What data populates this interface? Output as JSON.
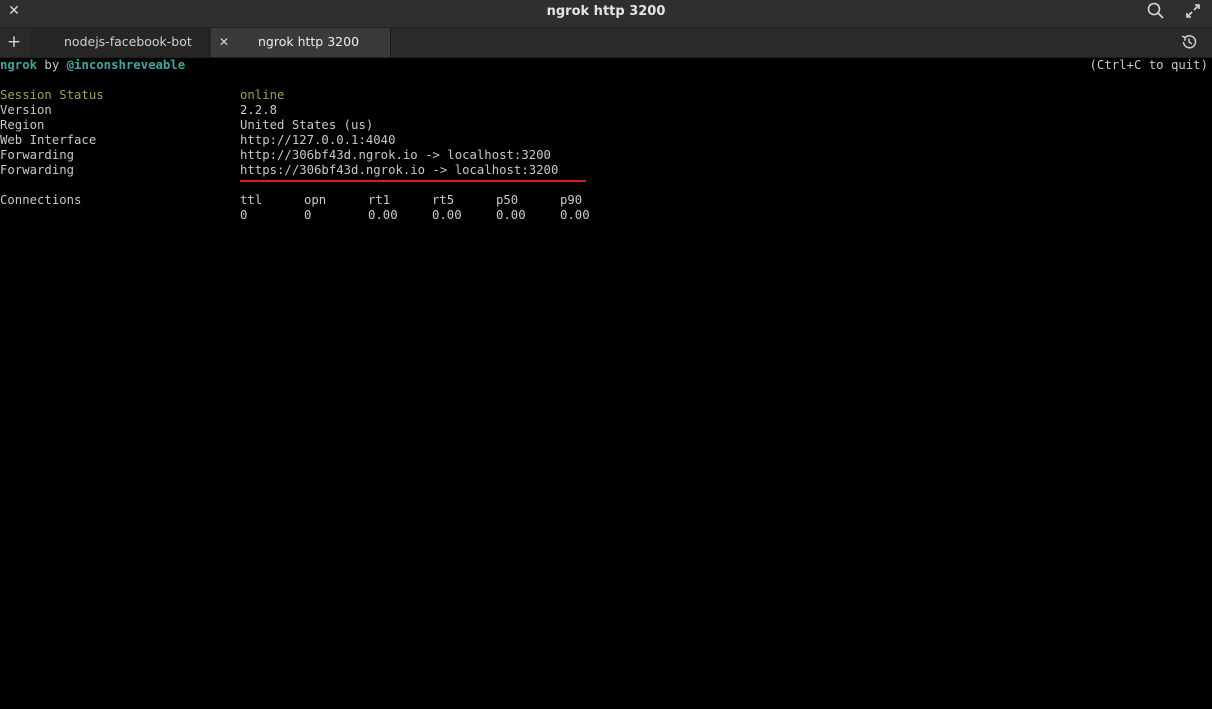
{
  "window": {
    "title": "ngrok http 3200",
    "close_glyph": "✕",
    "search_icon": "search-icon",
    "maximize_icon": "maximize-icon"
  },
  "tabs": {
    "new_tab_glyph": "+",
    "items": [
      {
        "label": "nodejs-facebook-bot",
        "active": false
      },
      {
        "label": "ngrok http 3200",
        "active": true,
        "close_glyph": "✕"
      }
    ],
    "history_icon": "history-icon"
  },
  "terminal": {
    "header": {
      "brand": "ngrok",
      "by": " by ",
      "author": "@inconshreveable",
      "quit_hint": "(Ctrl+C to quit)"
    },
    "fields": [
      {
        "label": "Session Status",
        "value": "online"
      },
      {
        "label": "Version",
        "value": "2.2.8"
      },
      {
        "label": "Region",
        "value": "United States (us)"
      },
      {
        "label": "Web Interface",
        "value": "http://127.0.0.1:4040"
      },
      {
        "label": "Forwarding",
        "value": "http://306bf43d.ngrok.io -> localhost:3200"
      },
      {
        "label": "Forwarding",
        "value": "https://306bf43d.ngrok.io -> localhost:3200"
      }
    ],
    "connections": {
      "label": "Connections",
      "headers": [
        "ttl",
        "opn",
        "rt1",
        "rt5",
        "p50",
        "p90"
      ],
      "values": [
        "0",
        "0",
        "0.00",
        "0.00",
        "0.00",
        "0.00"
      ]
    }
  },
  "colors": {
    "accent_teal": "#3aa8a0",
    "status_olive": "#a1a045",
    "highlight_red": "#d81e1e",
    "background": "#000000"
  }
}
